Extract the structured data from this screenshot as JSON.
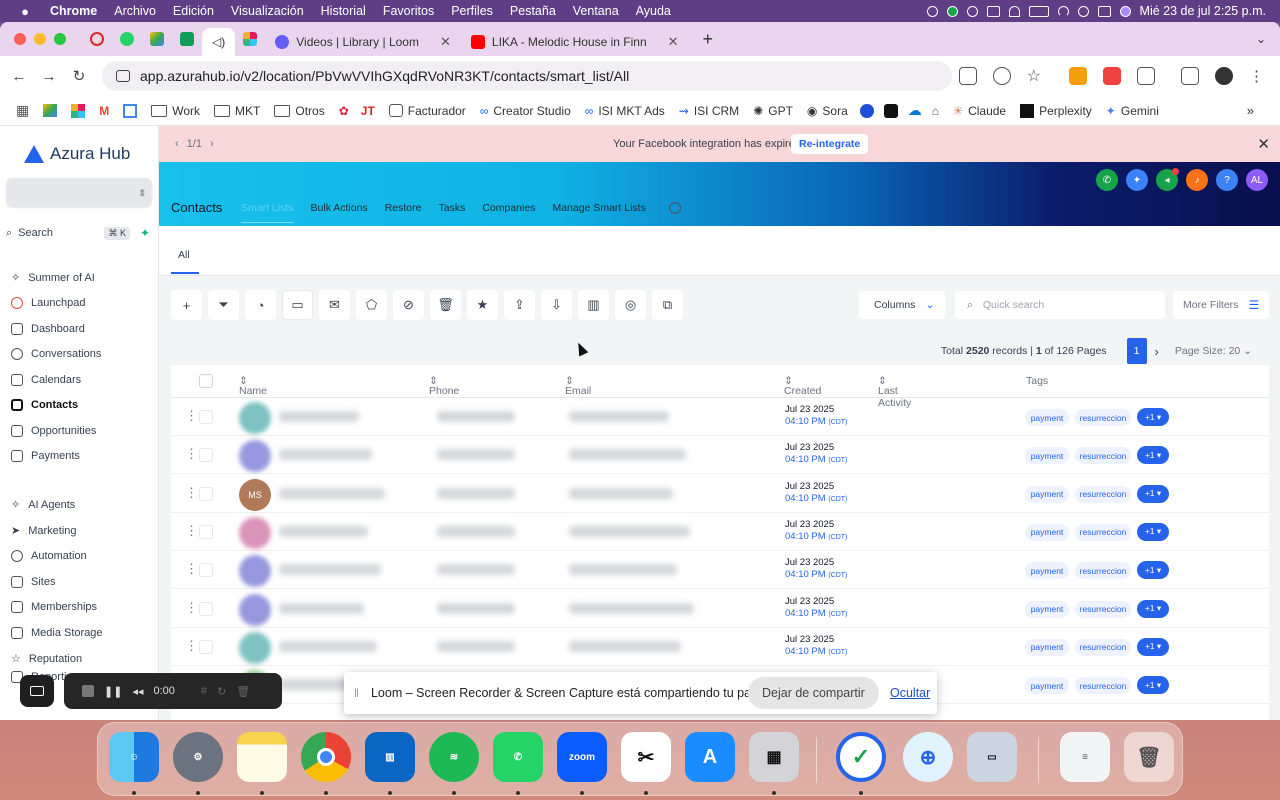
{
  "menubar": {
    "app": "Chrome",
    "items": [
      "Archivo",
      "Edición",
      "Visualización",
      "Historial",
      "Favoritos",
      "Perfiles",
      "Pestaña",
      "Ventana",
      "Ayuda"
    ],
    "clock": "Mié 23 de jul  2:25 p.m."
  },
  "tabs": {
    "loom": {
      "title": "Videos | Library | Loom"
    },
    "yt": {
      "title": "LIKA - Melodic House in Finn"
    }
  },
  "address": {
    "url": "app.azurahub.io/v2/location/PbVwVVIhGXqdRVoNR3KT/contacts/smart_list/All"
  },
  "bookmarks": [
    "Work",
    "MKT",
    "Otros",
    "Facturador",
    "Creator Studio",
    "ISI MKT Ads",
    "ISI CRM",
    "GPT",
    "Sora",
    "Claude",
    "Perplexity",
    "Gemini"
  ],
  "sidebar": {
    "logo": "Azura Hub",
    "search_label": "Search",
    "search_kbd": "⌘ K",
    "nav": [
      "Summer of AI",
      "Launchpad",
      "Dashboard",
      "Conversations",
      "Calendars",
      "Contacts",
      "Opportunities",
      "Payments",
      "AI Agents",
      "Marketing",
      "Automation",
      "Sites",
      "Memberships",
      "Media Storage",
      "Reputation",
      "Reporting"
    ]
  },
  "banner": {
    "pager": "1/1",
    "message": "Your Facebook integration has expired.",
    "button": "Re-integrate"
  },
  "header": {
    "title": "Contacts",
    "subtabs": [
      "Smart Lists",
      "Bulk Actions",
      "Restore",
      "Tasks",
      "Companies",
      "Manage Smart Lists"
    ],
    "avatar": "AL"
  },
  "list": {
    "tab": "All",
    "columns_btn": "Columns",
    "quick_search": "Quick search",
    "more_filters": "More Filters",
    "total_prefix": "Total",
    "total": "2520",
    "records_text": "records |",
    "page": "1",
    "pages_text": "of 126 Pages",
    "page_btn": "1",
    "page_size": "Page Size: 20"
  },
  "table": {
    "headers": [
      "Name",
      "Phone",
      "Email",
      "Created",
      "Last Activity",
      "Tags"
    ],
    "rows": [
      {
        "date": "Jul 23 2025",
        "time": "04:10 PM",
        "tz": "(CDT)",
        "tag1": "payment",
        "tag2": "resurreccion",
        "more": "+1 ▾"
      },
      {
        "date": "Jul 23 2025",
        "time": "04:10 PM",
        "tz": "(CDT)",
        "tag1": "payment",
        "tag2": "resurreccion",
        "more": "+1 ▾"
      },
      {
        "date": "Jul 23 2025",
        "time": "04:10 PM",
        "tz": "(CDT)",
        "tag1": "payment",
        "tag2": "resurreccion",
        "more": "+1 ▾",
        "initials": "MS"
      },
      {
        "date": "Jul 23 2025",
        "time": "04:10 PM",
        "tz": "(CDT)",
        "tag1": "payment",
        "tag2": "resurreccion",
        "more": "+1 ▾"
      },
      {
        "date": "Jul 23 2025",
        "time": "04:10 PM",
        "tz": "(CDT)",
        "tag1": "payment",
        "tag2": "resurreccion",
        "more": "+1 ▾"
      },
      {
        "date": "Jul 23 2025",
        "time": "04:10 PM",
        "tz": "(CDT)",
        "tag1": "payment",
        "tag2": "resurreccion",
        "more": "+1 ▾"
      },
      {
        "date": "Jul 23 2025",
        "time": "04:10 PM",
        "tz": "(CDT)",
        "tag1": "payment",
        "tag2": "resurreccion",
        "more": "+1 ▾"
      },
      {
        "date": "",
        "time": "",
        "tz": "",
        "tag1": "payment",
        "tag2": "resurreccion",
        "more": "+1 ▾"
      }
    ]
  },
  "loom": {
    "message": "Loom – Screen Recorder & Screen Capture está compartiendo tu pantalla.",
    "stop": "Dejar de compartir",
    "hide": "Ocultar",
    "timer": "0:00"
  },
  "dock": {
    "zoom_label": "zoom"
  },
  "colors": {
    "accent": "#2563eb",
    "banner": "#f7d7d7",
    "menubar": "#5e3f86"
  }
}
